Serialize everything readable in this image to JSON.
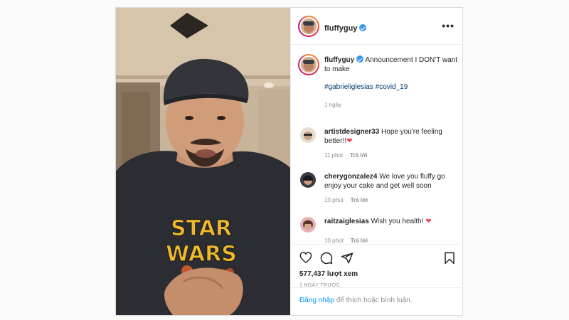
{
  "post": {
    "username": "fluffyguy",
    "caption": "Announcement I DON'T want to make",
    "hashtags": "#gabrieliglesias #covid_19",
    "posted_ago": "1 ngày"
  },
  "comments": [
    {
      "user": "artistdesigner33",
      "text": "Hope you're feeling better!!",
      "emoji": "❤",
      "time": "11 phút",
      "reply": "Trả lời"
    },
    {
      "user": "cherygonzalez4",
      "text": "We love you fluffy go enjoy your cake and get well soon",
      "emoji": "",
      "time": "10 phút",
      "reply": "Trả lời"
    },
    {
      "user": "raitzaiglesias",
      "text": "Wish you health!",
      "emoji": "❤",
      "time": "10 phút",
      "reply": "Trả lời"
    }
  ],
  "stats": {
    "views": "577,437 lượt xem",
    "ago_caps": "1 NGÀY TRƯỚC"
  },
  "login": {
    "link": "Đăng nhập",
    "rest": " để thích hoặc bình luận."
  },
  "media": {
    "shirt_text_line1": "STAR",
    "shirt_text_line2": "WARS"
  },
  "icons": {
    "more": "more-options-icon",
    "like": "heart-icon",
    "comment": "comment-icon",
    "share": "share-icon",
    "save": "bookmark-icon",
    "verified": "verified-badge-icon"
  }
}
